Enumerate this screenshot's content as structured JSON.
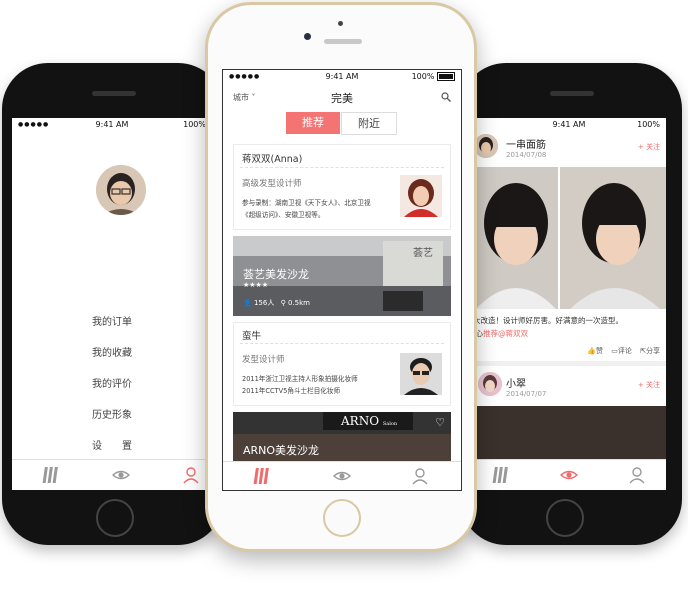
{
  "left_phone": {
    "status": {
      "time": "9:41 AM",
      "battery": "100%"
    },
    "menu": [
      "我的订单",
      "我的收藏",
      "我的评价",
      "历史形象",
      "设　　置"
    ],
    "tabs": [
      "comb-icon",
      "eye-icon",
      "person-icon"
    ]
  },
  "center_phone": {
    "status": {
      "time": "9:41 AM",
      "battery": "100%"
    },
    "nav": {
      "city": "城市",
      "title": "完美"
    },
    "segments": {
      "recommend": "推荐",
      "nearby": "附近"
    },
    "stylist1": {
      "name": "蒋双双(Anna)",
      "role": "高级发型设计师",
      "desc_line1": "参与录制：湖南卫视《天下女人》、北京卫视",
      "desc_line2": "《超级访问》、安徽卫视等。"
    },
    "salon1": {
      "name": "荟艺美发沙龙",
      "stars": "★★★★",
      "people": "156人",
      "distance": "0.5km",
      "sign": "荟艺"
    },
    "stylist2": {
      "name": "蛮牛",
      "role": "发型设计师",
      "desc_line1": "2011年浙江卫视主持人形象拍摄化妆师",
      "desc_line2": "2011年CCTV5角斗士栏目化妆师"
    },
    "salon2": {
      "name": "ARNO美发沙龙",
      "sign": "ARNO",
      "sign_sub": "Salon"
    }
  },
  "right_phone": {
    "status": {
      "time": "9:41 AM",
      "battery": "100%"
    },
    "post1": {
      "user": "一串面筋",
      "date": "2014/07/08",
      "follow": "+ 关注",
      "text_line1": "形象大改造！设计师好厉害。好满意的一次造型。",
      "text_line2_prefix": "开心",
      "mention": "推荐@蒋双双",
      "actions": {
        "like": "赞",
        "comment": "评论",
        "share": "分享"
      }
    },
    "post2": {
      "user": "小翠",
      "date": "2014/07/07",
      "follow": "+ 关注"
    }
  },
  "colors": {
    "accent": "#f06b6b",
    "gold": "#d8c9a4",
    "phone_black": "#121212"
  }
}
